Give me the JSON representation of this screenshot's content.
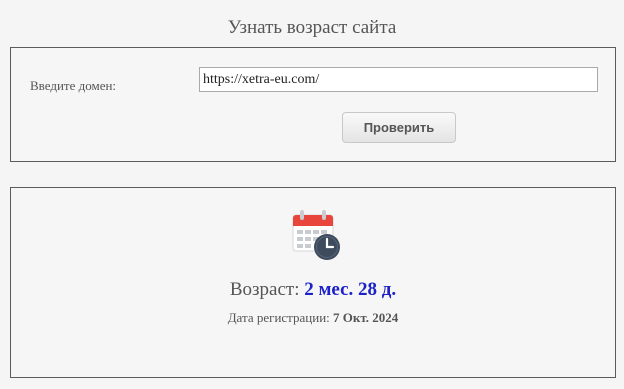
{
  "page": {
    "title": "Узнать возраст сайта"
  },
  "form": {
    "domain_label": "Введите домен:",
    "domain_value": "https://xetra-eu.com/",
    "submit_label": "Проверить"
  },
  "result": {
    "icon": "calendar-clock-icon",
    "age_label": "Возраст:",
    "age_value": "2 мес. 28 д.",
    "registration_label": "Дата регистрации:",
    "registration_value": "7 Окт. 2024"
  },
  "colors": {
    "age_value": "#1c22c8",
    "calendar_header": "#e8453c",
    "clock": "#3d4b5c"
  }
}
